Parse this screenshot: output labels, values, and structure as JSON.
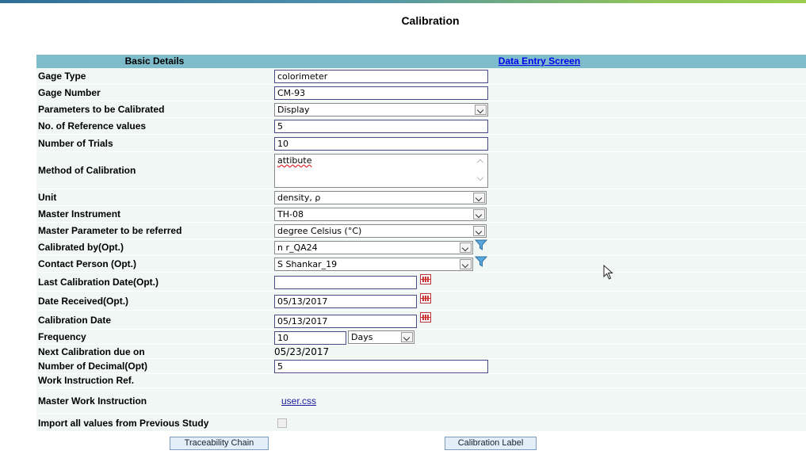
{
  "page_title": "Calibration",
  "section": {
    "left": "Basic Details",
    "right_link": "Data Entry Screen"
  },
  "fields": {
    "gage_type": {
      "label": "Gage Type",
      "value": "colorimeter"
    },
    "gage_number": {
      "label": "Gage Number",
      "value": "CM-93"
    },
    "parameters": {
      "label": "Parameters to be Calibrated",
      "value": "Display"
    },
    "ref_values": {
      "label": "No. of Reference values",
      "value": "5"
    },
    "trials": {
      "label": "Number of Trials",
      "value": "10"
    },
    "method": {
      "label": "Method of Calibration",
      "value": "attibute"
    },
    "unit": {
      "label": "Unit",
      "value": "density, ρ"
    },
    "master_instrument": {
      "label": "Master Instrument",
      "value": "TH-08"
    },
    "master_parameter": {
      "label": "Master Parameter to be referred",
      "value": "degree Celsius (°C)"
    },
    "calibrated_by": {
      "label": "Calibrated by(Opt.)",
      "value": "n r_QA24"
    },
    "contact_person": {
      "label": "Contact Person (Opt.)",
      "value": "S Shankar_19"
    },
    "last_cal_date": {
      "label": "Last Calibration Date(Opt.)",
      "value": ""
    },
    "date_received": {
      "label": "Date Received(Opt.)",
      "value": "05/13/2017"
    },
    "cal_date": {
      "label": "Calibration Date",
      "value": "05/13/2017"
    },
    "frequency": {
      "label": "Frequency",
      "value": "10",
      "unit": "Days"
    },
    "next_due": {
      "label": "Next Calibration due on",
      "value": "05/23/2017"
    },
    "decimals": {
      "label": "Number of Decimal(Opt)",
      "value": "5"
    },
    "work_instruction": {
      "label": "Work Instruction Ref."
    },
    "master_work_instruction": {
      "label": "Master Work Instruction",
      "link": "user.css"
    },
    "import_prev": {
      "label": "Import all values from Previous Study"
    }
  },
  "buttons": {
    "traceability": "Traceability Chain",
    "cal_label": "Calibration Label"
  },
  "colors": {
    "header_bar": "#7fbccb",
    "row_bg": "#f1f7f5",
    "link": "#0000ee"
  }
}
